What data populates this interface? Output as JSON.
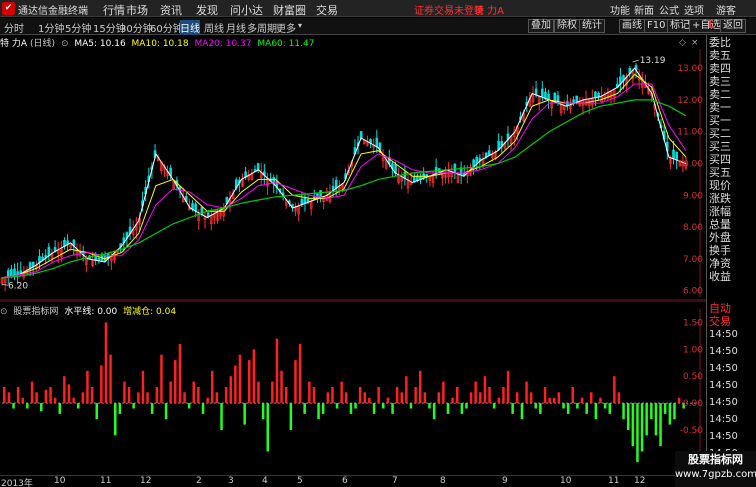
{
  "titlebar": {
    "app_name": "通达信金融终端",
    "menu": [
      "行情",
      "市场",
      "资讯",
      "发现",
      "问小达",
      "财富圈",
      "交易"
    ],
    "alert": "证券交易未登录",
    "title": "特 力A",
    "right_menu": [
      "功能",
      "新面",
      "公式",
      "选项",
      "游客"
    ]
  },
  "toolbar": {
    "periods": [
      "分时",
      "1分钟",
      "5分钟",
      "15分钟",
      "30分钟",
      "60分钟",
      "日线",
      "周线",
      "月线",
      "多周期",
      "更多"
    ],
    "active_period": "日线",
    "buttons": [
      "叠加",
      "除权",
      "统计",
      "画线",
      "F10",
      "标记",
      "+自选",
      "返回"
    ]
  },
  "chart_header": {
    "name": "特 力A",
    "period": "(日线)",
    "ma": [
      {
        "label": "MA5: 10.16",
        "color": "#ffffff"
      },
      {
        "label": "MA10: 10.18",
        "color": "#ffff00"
      },
      {
        "label": "MA20: 10.37",
        "color": "#ff00ff"
      },
      {
        "label": "MA60: 11.47",
        "color": "#00ff00"
      }
    ]
  },
  "indicator_header": {
    "name": "股票指标网",
    "items": [
      {
        "label": "水平线: 0.00",
        "color": "#ffffff"
      },
      {
        "label": "增减仓: 0.04",
        "color": "#ffff00"
      }
    ]
  },
  "right_panel": {
    "logo": "L",
    "labels": [
      "委比",
      "卖五",
      "卖四",
      "卖三",
      "卖二",
      "卖一",
      "买一",
      "买二",
      "买三",
      "买四",
      "买五",
      "现价",
      "涨跌",
      "涨幅",
      "总量",
      "外盘",
      "换手",
      "净资",
      "收益"
    ],
    "auto": [
      "自动",
      "交易"
    ],
    "times": [
      "14:50",
      "14:50",
      "14:50",
      "14:50",
      "14:50",
      "14:50",
      "14:50",
      "14:50"
    ]
  },
  "dates": [
    "2013年",
    "10",
    "11",
    "12",
    "2",
    "3",
    "4",
    "5",
    "6",
    "7",
    "8",
    "9",
    "10",
    "11",
    "12"
  ],
  "watermark": {
    "line1": "股票指标网",
    "line2": "www.7gpzb.com"
  },
  "chart_data": [
    {
      "type": "line",
      "title": "",
      "ylim": [
        5.8,
        13.6
      ],
      "yticks": [
        6,
        7,
        8,
        9,
        10,
        11,
        12,
        13
      ],
      "annotations": [
        {
          "text": "13.19",
          "value": 13.19
        },
        {
          "text": "6.20",
          "value": 6.2
        }
      ],
      "series": [
        {
          "name": "MA5",
          "color": "#ffffff",
          "values": [
            6.4,
            6.5,
            6.8,
            7.2,
            7.5,
            7.0,
            6.9,
            7.4,
            8.2,
            10.3,
            9.5,
            8.6,
            8.3,
            8.6,
            9.5,
            9.8,
            9.3,
            8.6,
            8.8,
            9.0,
            9.4,
            10.8,
            10.5,
            9.7,
            9.4,
            9.6,
            9.8,
            9.6,
            10.1,
            10.4,
            11.0,
            12.2,
            12.0,
            11.8,
            12.0,
            12.1,
            12.4,
            13.0,
            12.2,
            10.2,
            10.0
          ]
        },
        {
          "name": "MA10",
          "color": "#ffff00",
          "values": [
            6.4,
            6.5,
            6.7,
            7.0,
            7.3,
            7.2,
            7.0,
            7.2,
            7.8,
            9.3,
            9.5,
            9.0,
            8.5,
            8.5,
            9.1,
            9.5,
            9.5,
            9.0,
            8.9,
            8.9,
            9.2,
            10.3,
            10.4,
            10.0,
            9.6,
            9.6,
            9.7,
            9.7,
            9.9,
            10.2,
            10.7,
            11.8,
            12.0,
            11.9,
            11.9,
            12.0,
            12.2,
            12.8,
            12.4,
            10.8,
            10.2
          ]
        },
        {
          "name": "MA20",
          "color": "#ff00ff",
          "values": [
            6.4,
            6.5,
            6.6,
            6.9,
            7.1,
            7.2,
            7.1,
            7.1,
            7.6,
            8.7,
            9.2,
            9.1,
            8.7,
            8.6,
            8.9,
            9.3,
            9.4,
            9.2,
            9.0,
            8.9,
            9.0,
            9.9,
            10.3,
            10.1,
            9.8,
            9.7,
            9.7,
            9.7,
            9.8,
            10.0,
            10.5,
            11.4,
            11.9,
            11.9,
            11.9,
            11.9,
            12.1,
            12.5,
            12.5,
            11.2,
            10.4
          ]
        },
        {
          "name": "MA60",
          "color": "#00cc00",
          "values": [
            6.4,
            6.45,
            6.55,
            6.7,
            6.9,
            7.05,
            7.15,
            7.3,
            7.5,
            7.8,
            8.1,
            8.3,
            8.5,
            8.6,
            8.75,
            8.85,
            8.95,
            9.0,
            9.05,
            9.1,
            9.15,
            9.3,
            9.5,
            9.6,
            9.7,
            9.75,
            9.8,
            9.85,
            9.9,
            10.0,
            10.2,
            10.6,
            11.0,
            11.3,
            11.6,
            11.8,
            11.9,
            12.0,
            12.0,
            11.8,
            11.5
          ]
        }
      ]
    },
    {
      "type": "bar",
      "title": "",
      "ylim": [
        -1.3,
        1.75
      ],
      "yticks": [
        1.5,
        1.0,
        0.5,
        0,
        -0.5,
        -1.0
      ],
      "ytick_labels": [
        "1.50",
        "1.00",
        "0.50",
        "0.00",
        "-0.50",
        "-1.00"
      ],
      "baseline": 0.0,
      "series": [
        {
          "name": "增减仓",
          "values": [
            0.3,
            0.2,
            -0.1,
            0.3,
            0.1,
            -0.1,
            0.4,
            0.2,
            -0.15,
            0.25,
            0.3,
            0.1,
            -0.2,
            0.5,
            0.35,
            0.1,
            -0.1,
            0.2,
            0.6,
            0.3,
            -0.3,
            0.7,
            1.5,
            0.9,
            -0.6,
            -0.2,
            0.4,
            0.3,
            -0.1,
            0.2,
            0.6,
            0.2,
            -0.2,
            0.3,
            0.9,
            -0.3,
            0.4,
            0.8,
            1.1,
            0.2,
            -0.1,
            0.4,
            0.3,
            -0.2,
            0.1,
            0.6,
            0.2,
            -0.5,
            0.3,
            0.5,
            0.7,
            0.9,
            -0.4,
            0.8,
            1.0,
            0.4,
            -0.3,
            -0.9,
            0.4,
            1.2,
            0.6,
            0.3,
            -0.5,
            0.8,
            1.1,
            -0.2,
            0.4,
            0.3,
            -0.3,
            -0.2,
            0.2,
            0.3,
            -0.1,
            0.4,
            0.2,
            -0.2,
            -0.1,
            0.3,
            0.2,
            0.1,
            -0.2,
            0.3,
            -0.1,
            0.1,
            -0.2,
            0.3,
            0.2,
            0.5,
            -0.1,
            0.3,
            0.6,
            0.2,
            -0.1,
            -0.3,
            0.2,
            0.4,
            -0.2,
            0.1,
            0.3,
            -0.2,
            -0.1,
            0.2,
            0.4,
            0.2,
            0.5,
            0.3,
            -0.1,
            0.1,
            0.3,
            0.6,
            -0.2,
            0.2,
            -0.3,
            0.4,
            0.2,
            -0.1,
            -0.2,
            0.3,
            0.1,
            0.1,
            0.2,
            -0.1,
            -0.2,
            0.3,
            -0.1,
            0.1,
            -0.2,
            0.2,
            -0.3,
            0.1,
            -0.1,
            -0.2,
            0.5,
            0.2,
            -0.3,
            -0.5,
            -0.8,
            -1.1,
            -0.9,
            -0.6,
            -0.3,
            -0.6,
            -0.8,
            -0.2,
            -0.4,
            -0.3,
            0.1,
            -0.1
          ]
        }
      ]
    }
  ]
}
